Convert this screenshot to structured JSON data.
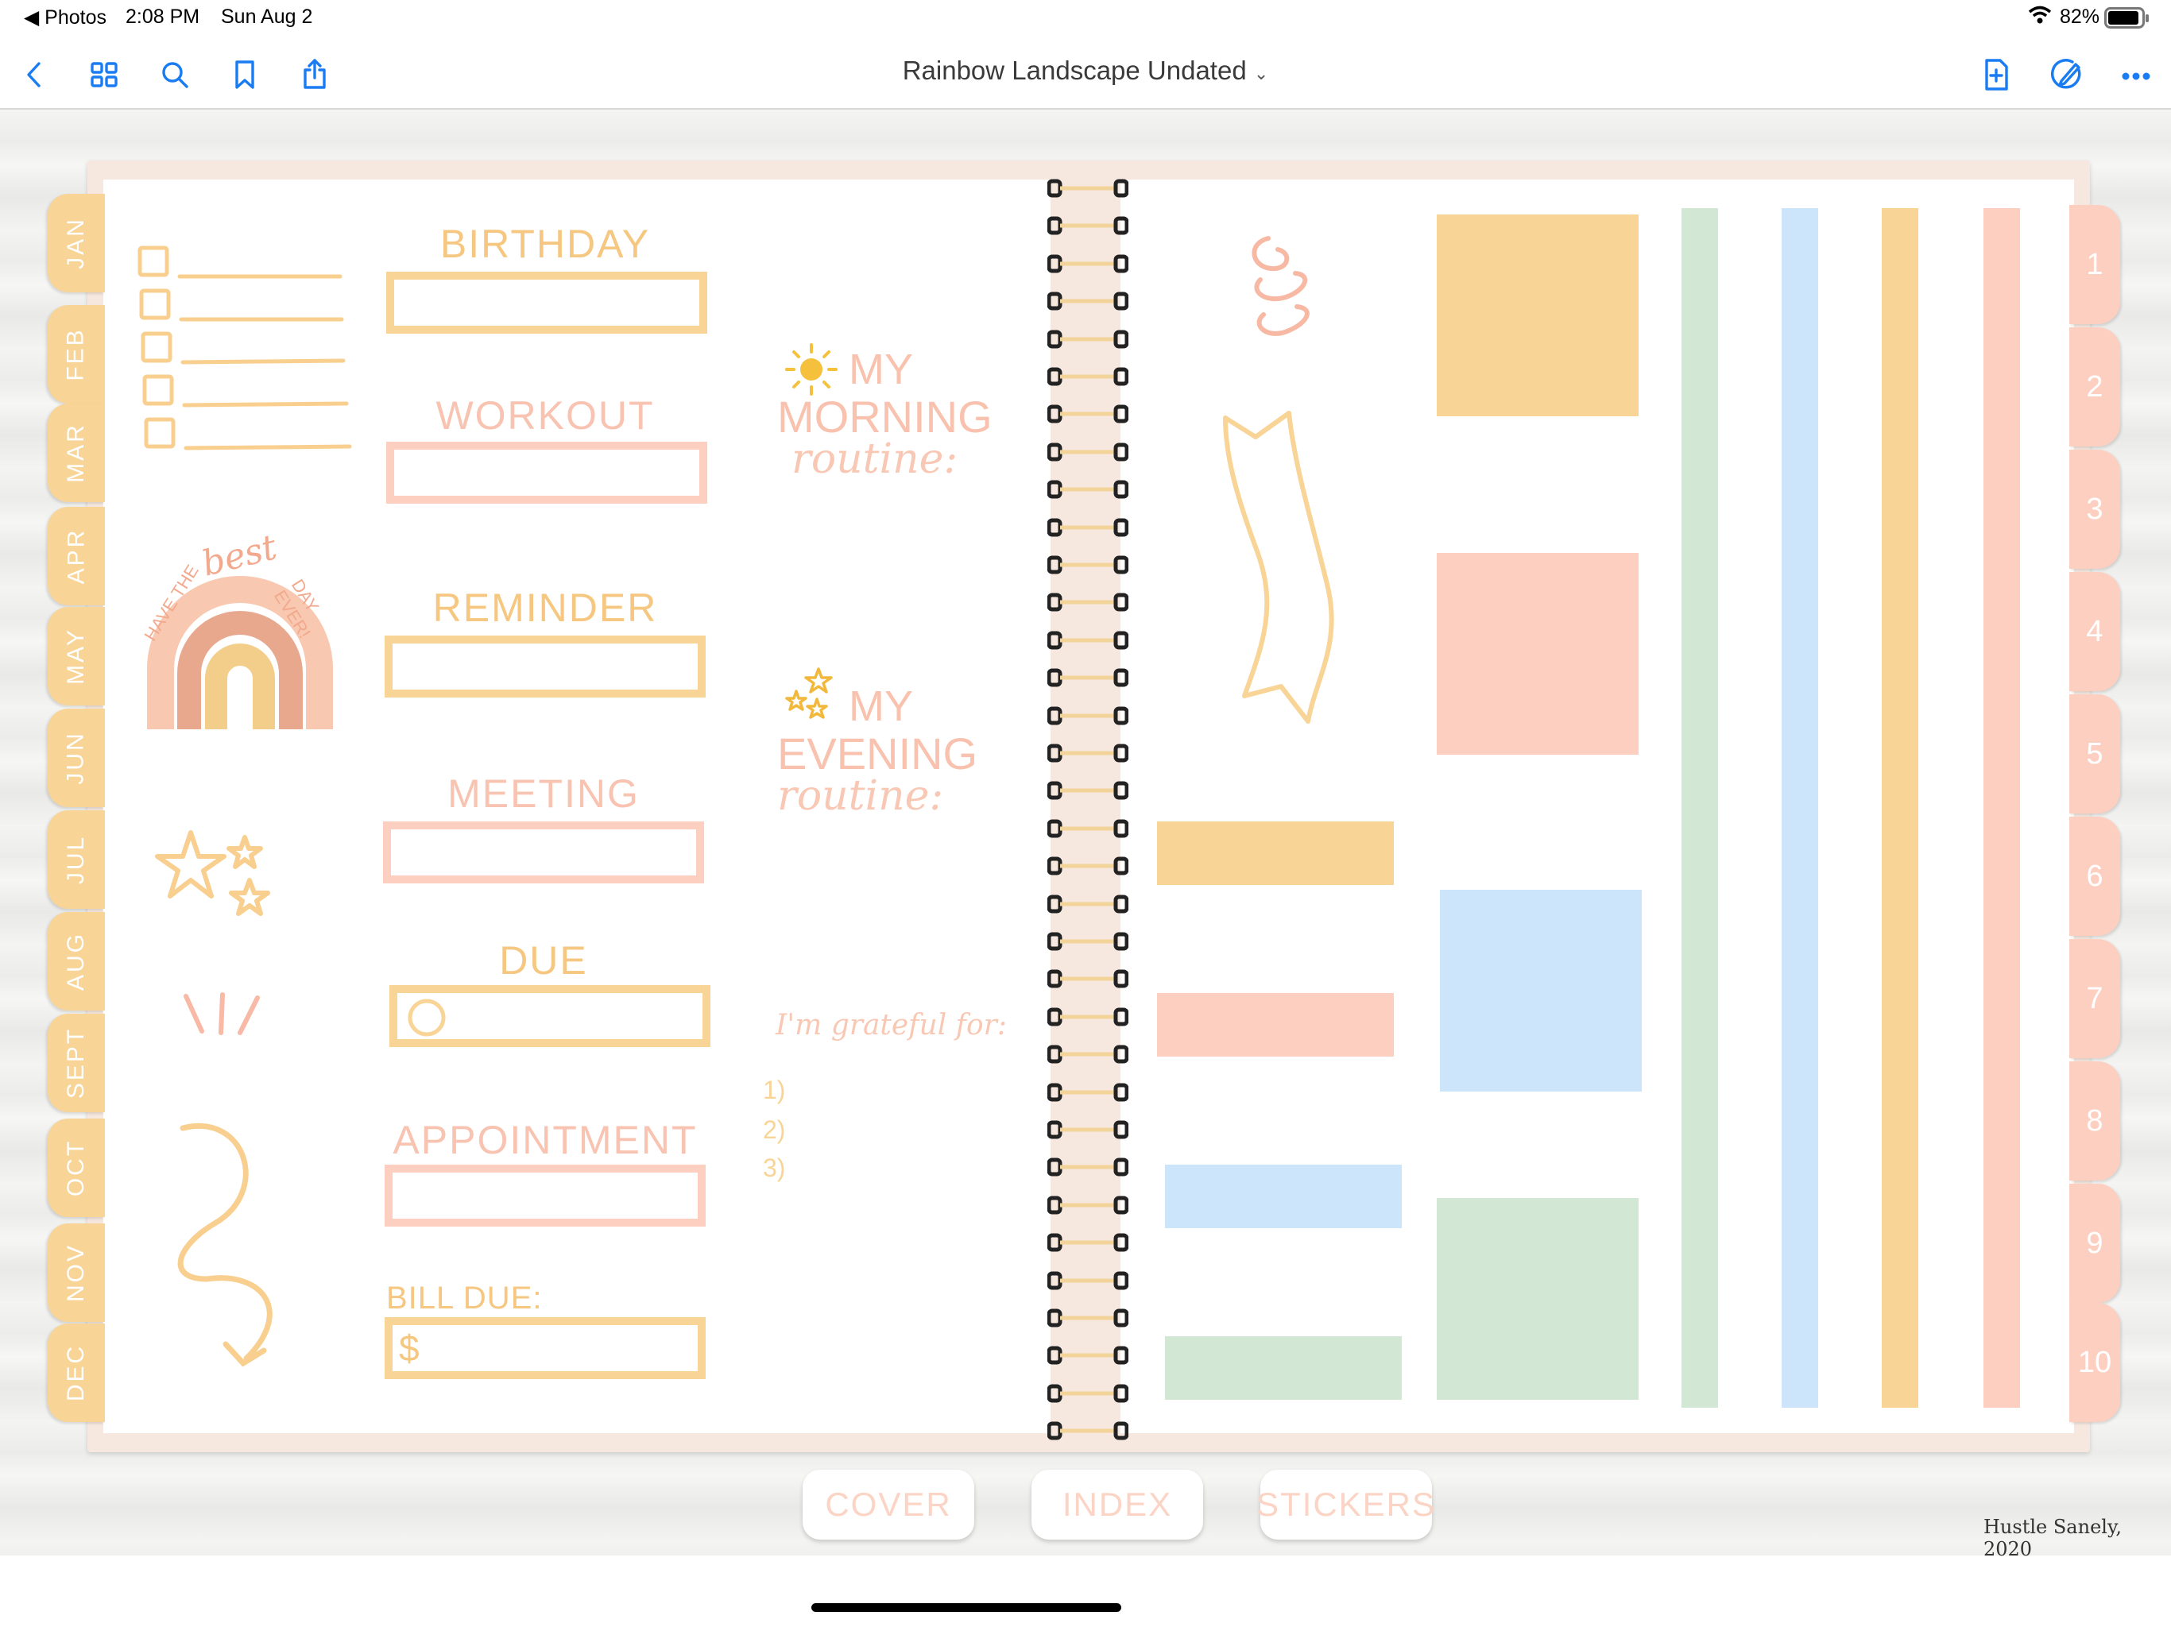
{
  "status_bar": {
    "back_app": "◀ Photos",
    "time": "2:08 PM",
    "date": "Sun Aug 2",
    "battery": "82%"
  },
  "toolbar": {
    "title": "Rainbow Landscape Undated",
    "icons": [
      "back-icon",
      "thumbnails-icon",
      "search-icon",
      "bookmark-icon",
      "share-icon",
      "add-page-icon",
      "markup-icon",
      "more-icon"
    ]
  },
  "months": [
    "JAN",
    "FEB",
    "MAR",
    "APR",
    "MAY",
    "JUN",
    "JUL",
    "AUG",
    "SEPT",
    "OCT",
    "NOV",
    "DEC"
  ],
  "number_tabs": [
    "1",
    "2",
    "3",
    "4",
    "5",
    "6",
    "7",
    "8",
    "9",
    "10"
  ],
  "left_page": {
    "labels": {
      "birthday": "BIRTHDAY",
      "workout": "WORKOUT",
      "reminder": "REMINDER",
      "meeting": "MEETING",
      "due": "DUE",
      "appointment": "APPOINTMENT",
      "bill_due": "BILL DUE:",
      "dollar": "$"
    },
    "rainbow_text": {
      "have_the": "HAVE THE",
      "best": "best",
      "day_ever": "DAY EVER!"
    },
    "morning": {
      "my": "MY",
      "main": "MORNING",
      "script": "routine:"
    },
    "evening": {
      "my": "MY",
      "main": "EVENING",
      "script": "routine:"
    },
    "grateful": {
      "title": "I'm grateful for:",
      "items": [
        "1)",
        "2)",
        "3)"
      ]
    }
  },
  "colors": {
    "yellow": "#f8d496",
    "peach": "#fccfc0",
    "blue": "#cce5fb",
    "green": "#d3e8d4",
    "ring": "#222222",
    "accent": "#1a7cf2"
  },
  "bottom_nav": {
    "cover": "COVER",
    "index": "INDEX",
    "stickers": "STICKERS"
  },
  "credit": "Hustle Sanely, 2020"
}
